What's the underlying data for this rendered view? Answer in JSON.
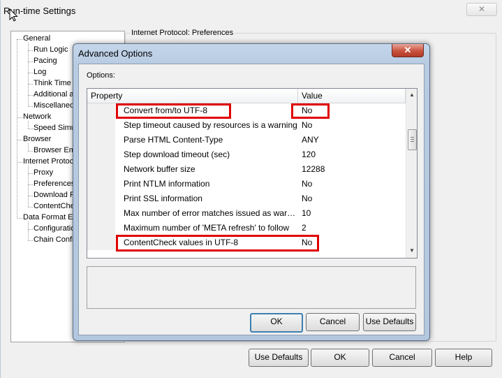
{
  "window": {
    "title": "Run-time Settings",
    "close_glyph": "✕",
    "group_label": "Internet Protocol: Preferences",
    "buttons": {
      "use_defaults": "Use Defaults",
      "ok": "OK",
      "cancel": "Cancel",
      "help": "Help"
    }
  },
  "tree": {
    "items": [
      {
        "label": "General",
        "level": 0
      },
      {
        "label": "Run Logic",
        "level": 1
      },
      {
        "label": "Pacing",
        "level": 1
      },
      {
        "label": "Log",
        "level": 1
      },
      {
        "label": "Think Time",
        "level": 1
      },
      {
        "label": "Additional a",
        "level": 1
      },
      {
        "label": "Miscellaneo",
        "level": 1
      },
      {
        "label": "Network",
        "level": 0
      },
      {
        "label": "Speed Simu",
        "level": 1
      },
      {
        "label": "Browser",
        "level": 0
      },
      {
        "label": "Browser Em",
        "level": 1
      },
      {
        "label": "Internet Protoco",
        "level": 0
      },
      {
        "label": "Proxy",
        "level": 1
      },
      {
        "label": "Preferences",
        "level": 1
      },
      {
        "label": "Download F",
        "level": 1
      },
      {
        "label": "ContentChe",
        "level": 1
      },
      {
        "label": "Data Format Ex",
        "level": 0
      },
      {
        "label": "Configuration",
        "level": 1
      },
      {
        "label": "Chain Config",
        "level": 1
      }
    ]
  },
  "dialog": {
    "title": "Advanced Options",
    "close_glyph": "✕",
    "options_label": "Options:",
    "columns": {
      "property": "Property",
      "value": "Value"
    },
    "rows": [
      {
        "property": "Convert from/to UTF-8",
        "value": "No"
      },
      {
        "property": "Step timeout caused by resources is a warning",
        "value": "No"
      },
      {
        "property": "Parse HTML Content-Type",
        "value": "ANY"
      },
      {
        "property": "Step download timeout (sec)",
        "value": "120"
      },
      {
        "property": "Network buffer size",
        "value": "12288"
      },
      {
        "property": "Print NTLM information",
        "value": "No"
      },
      {
        "property": "Print SSL information",
        "value": "No"
      },
      {
        "property": "Max number of error matches issued as warnings",
        "value": "10"
      },
      {
        "property": "Maximum number of 'META refresh' to follow",
        "value": "2"
      },
      {
        "property": "ContentCheck values in UTF-8",
        "value": "No"
      }
    ],
    "buttons": {
      "ok": "OK",
      "cancel": "Cancel",
      "use_defaults": "Use Defaults"
    },
    "highlight_color": "#e00000"
  }
}
